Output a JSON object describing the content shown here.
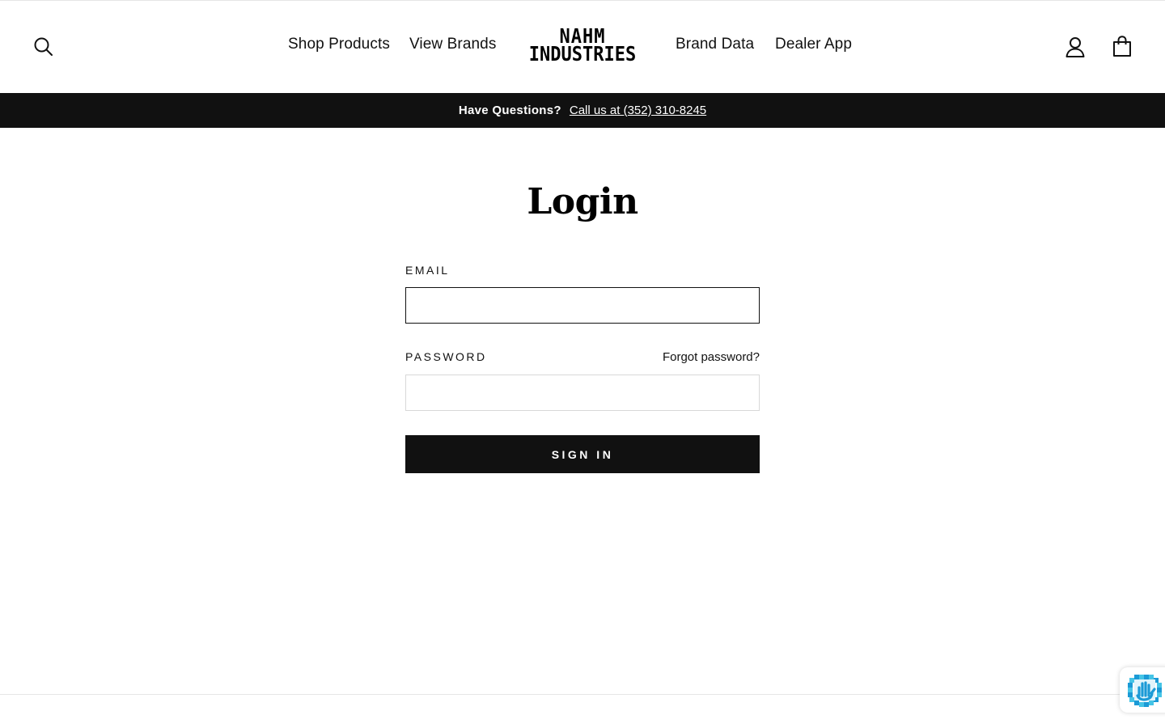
{
  "header": {
    "nav_left": [
      {
        "label": "Shop Products"
      },
      {
        "label": "View Brands"
      }
    ],
    "nav_right": [
      {
        "label": "Brand Data"
      },
      {
        "label": "Dealer App"
      }
    ],
    "logo": {
      "line1": "NAHM",
      "line2": "INDUSTRIES"
    },
    "icons": {
      "search": "search-icon",
      "account": "user-icon",
      "cart": "shopping-bag-icon"
    }
  },
  "announcement": {
    "question": "Have Questions?",
    "link_text": "Call us at (352) 310-8245",
    "background": "#111111",
    "text_color": "#ffffff"
  },
  "login": {
    "title": "Login",
    "email_label": "EMAIL",
    "email_value": "",
    "password_label": "PASSWORD",
    "password_value": "",
    "forgot_link": "Forgot password?",
    "submit_label": "SIGN IN",
    "button_color": "#111111"
  },
  "privacy_badge": {
    "icon": "recaptcha-hand-icon",
    "colors": [
      "#1b9ad6",
      "#45c4e6",
      "#e0f4fb"
    ]
  }
}
